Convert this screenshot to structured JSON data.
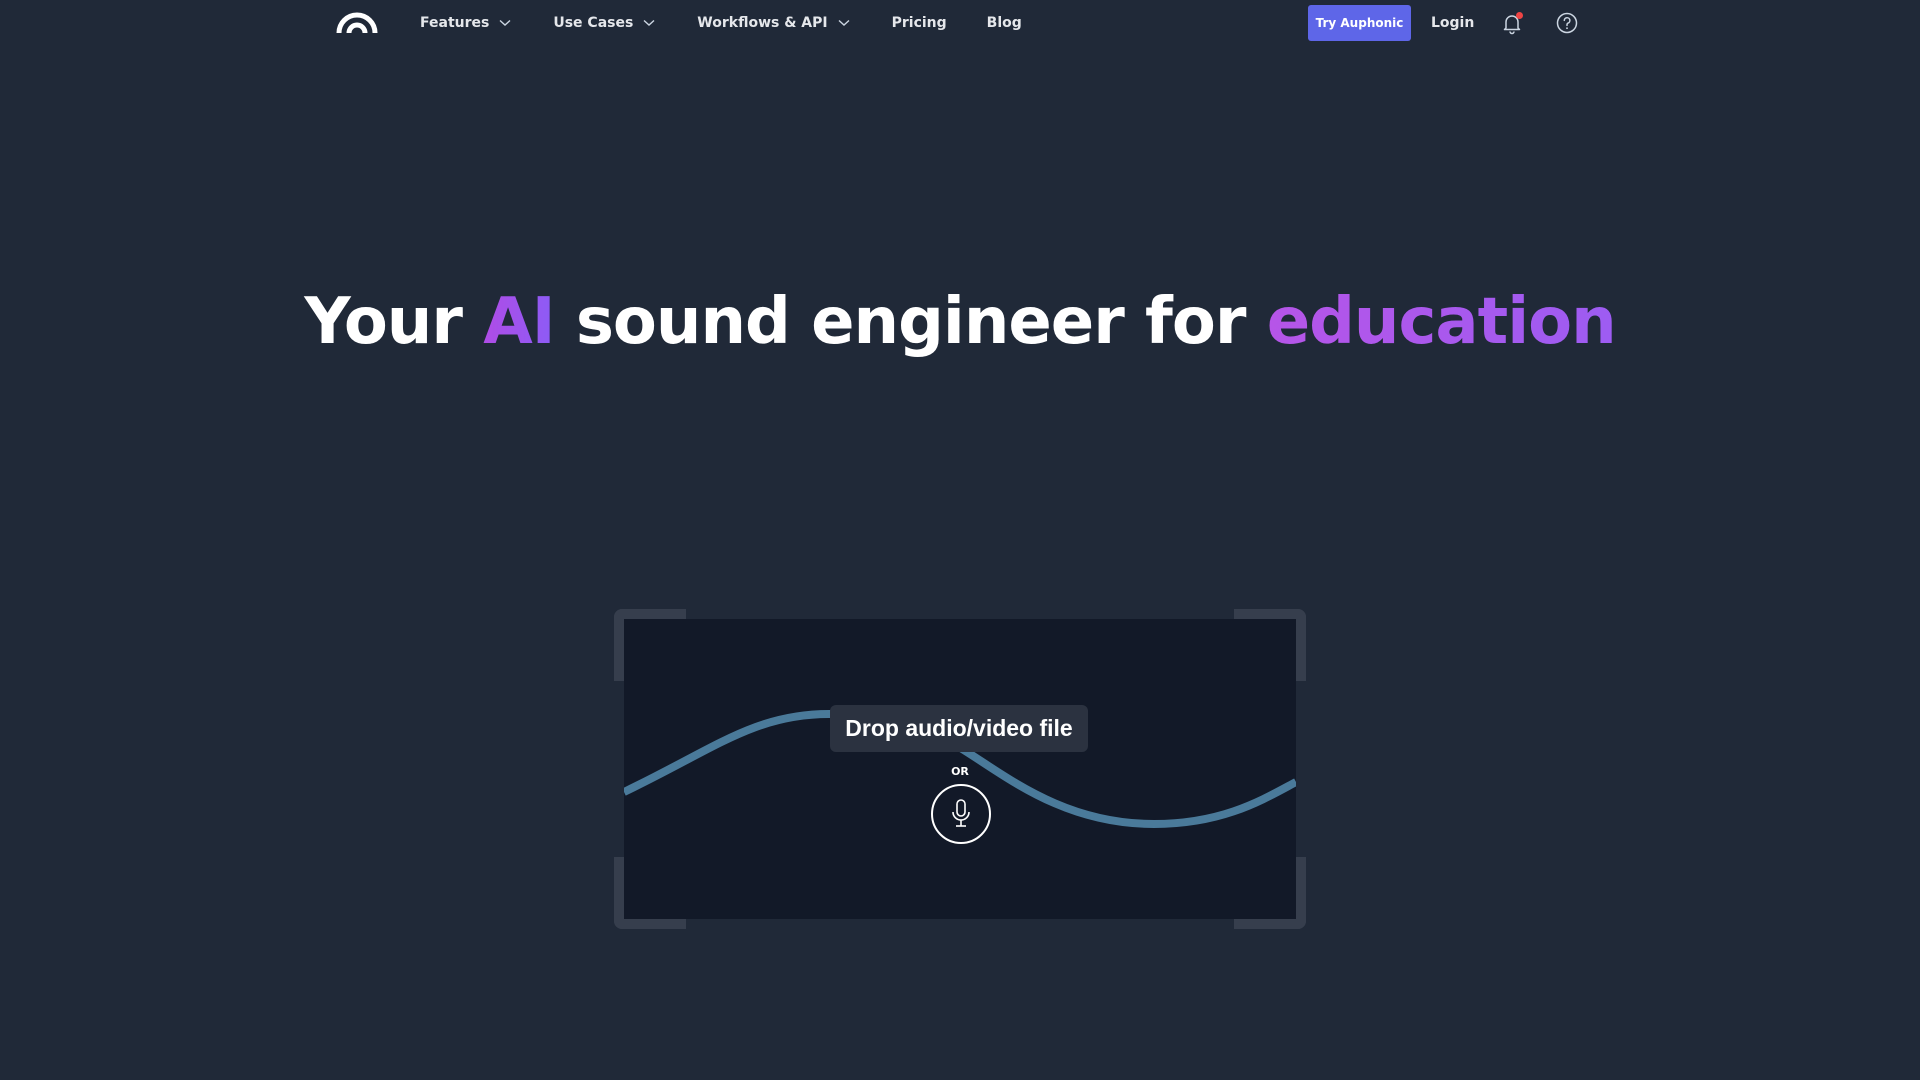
{
  "nav": {
    "logo_icon": "auphonic-logo-icon",
    "items": [
      {
        "label": "Features",
        "has_dropdown": true
      },
      {
        "label": "Use Cases",
        "has_dropdown": true
      },
      {
        "label": "Workflows & API",
        "has_dropdown": true
      },
      {
        "label": "Pricing",
        "has_dropdown": false
      },
      {
        "label": "Blog",
        "has_dropdown": false
      }
    ],
    "cta_label": "Try Auphonic",
    "login_label": "Login",
    "notification_icon": "bell-icon",
    "help_icon": "help-circle-icon"
  },
  "hero": {
    "part1": "Your ",
    "accent1": "AI",
    "part2": " sound engineer for ",
    "accent2": "education"
  },
  "dropzone": {
    "label": "Drop audio/video file",
    "or_text": "OR",
    "record_icon": "microphone-icon"
  },
  "colors": {
    "background": "#202938",
    "dropzone_bg": "#121928",
    "cta": "#5e66e8",
    "accent_purple": "#a855f7",
    "wave": "#4a7a9a",
    "notification_dot": "#ef4444"
  }
}
